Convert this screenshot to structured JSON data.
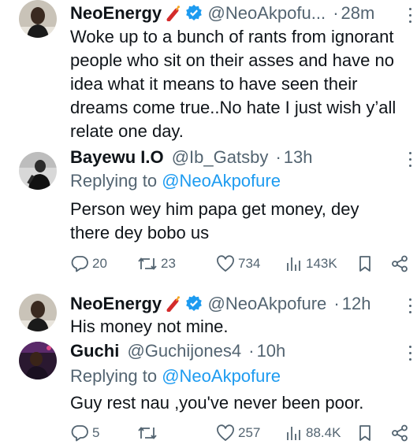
{
  "tweets": [
    {
      "author": "NeoEnergy",
      "handle": "@NeoAkpofu...",
      "time": "28m",
      "text_lines": [
        "Woke up to a bunch of rants from ignorant",
        "people who sit on their asses and have no",
        "idea what it means to have seen their",
        "dreams come true..No hate I just wish y’all",
        "relate one day."
      ],
      "icons": [
        "firecracker-emoji-icon",
        "verified-badge-icon",
        "more-options-icon"
      ]
    },
    {
      "author": "Bayewu I.O",
      "handle": "@Ib_Gatsby",
      "time": "13h",
      "replying_label": "Replying to",
      "replying_to": "@NeoAkpofure",
      "text_lines": [
        "Person wey him papa get money, dey",
        "there dey bobo us"
      ],
      "stats": {
        "replies": "20",
        "retweets": "23",
        "likes": "734",
        "views": "143K"
      }
    },
    {
      "author": "NeoEnergy",
      "handle": "@NeoAkpofure",
      "time": "12h",
      "text_lines": [
        "His money not mine."
      ]
    },
    {
      "author": "Guchi",
      "handle": "@Guchijones4",
      "time": "10h",
      "replying_label": "Replying to",
      "replying_to": "@NeoAkpofure",
      "text_lines": [
        "Guy rest nau ,you've never been poor."
      ],
      "stats": {
        "replies": "5",
        "retweets": "",
        "likes": "257",
        "views": "88.4K"
      }
    }
  ],
  "colors": {
    "text": "#0f1419",
    "muted": "#536471",
    "link": "#1d9bf0",
    "verified": "#1d9bf0"
  }
}
